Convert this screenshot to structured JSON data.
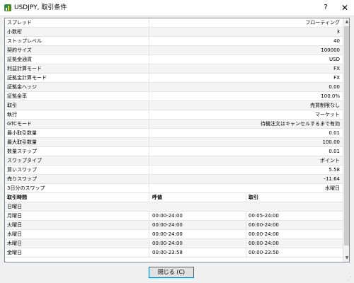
{
  "window": {
    "title": "USDJPY, 取引条件",
    "help_label": "?",
    "close_label": "✕"
  },
  "specs": [
    {
      "name": "スプレッド",
      "value": "フローティング"
    },
    {
      "name": "小数桁",
      "value": "3"
    },
    {
      "name": "ストップレベル",
      "value": "40"
    },
    {
      "name": "契約サイズ",
      "value": "100000"
    },
    {
      "name": "証拠金通貨",
      "value": "USD"
    },
    {
      "name": "利益計算モード",
      "value": "FX"
    },
    {
      "name": "証拠金計算モード",
      "value": "FX"
    },
    {
      "name": "証拠金ヘッジ",
      "value": "0.00"
    },
    {
      "name": "証拠金率",
      "value": "100.0%"
    },
    {
      "name": "取引",
      "value": "売買制限なし"
    },
    {
      "name": "執行",
      "value": "マーケット"
    },
    {
      "name": "GTCモード",
      "value": "待機注文はキャンセルするまで有効"
    },
    {
      "name": "最小取引数量",
      "value": "0.01"
    },
    {
      "name": "最大取引数量",
      "value": "100.00"
    },
    {
      "name": "数量ステップ",
      "value": "0.01"
    },
    {
      "name": "スワップタイプ",
      "value": "ポイント"
    },
    {
      "name": "買いスワップ",
      "value": "5.58"
    },
    {
      "name": "売りスワップ",
      "value": "-11.64"
    },
    {
      "name": "3日分のスワップ",
      "value": "水曜日"
    }
  ],
  "sessions": {
    "headers": [
      "取引時間",
      "呼値",
      "取引"
    ],
    "rows": [
      {
        "day": "日曜日",
        "quote": "",
        "trade": ""
      },
      {
        "day": "月曜日",
        "quote": "00:00-24:00",
        "trade": "00:05-24:00"
      },
      {
        "day": "火曜日",
        "quote": "00:00-24:00",
        "trade": "00:00-24:00"
      },
      {
        "day": "水曜日",
        "quote": "00:00-24:00",
        "trade": "00:00-24:00"
      },
      {
        "day": "木曜日",
        "quote": "00:00-24:00",
        "trade": "00:00-24:00"
      },
      {
        "day": "金曜日",
        "quote": "00:00-23:58",
        "trade": "00:00-23:50"
      }
    ]
  },
  "footer": {
    "close_button": "閉じる (C)"
  }
}
